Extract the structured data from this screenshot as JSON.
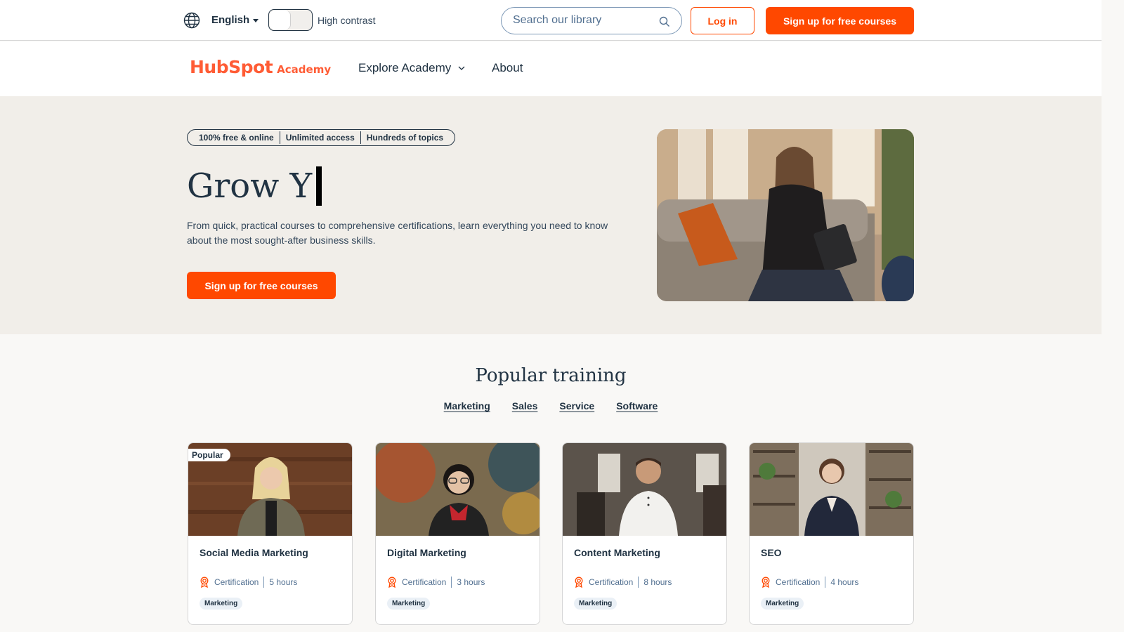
{
  "utility_bar": {
    "language": "English",
    "high_contrast_label": "High contrast",
    "search_placeholder": "Search our library",
    "login_label": "Log in",
    "signup_label": "Sign up for free courses"
  },
  "nav": {
    "logo_primary": "HubSpot",
    "logo_secondary": "Academy",
    "explore_label": "Explore Academy",
    "about_label": "About"
  },
  "hero": {
    "pills": [
      "100% free & online",
      "Unlimited access",
      "Hundreds of topics"
    ],
    "headline": "Grow Y",
    "subtext": "From quick, practical courses to comprehensive certifications, learn everything you need to know about the most sought-after business skills.",
    "cta_label": "Sign up for free courses"
  },
  "popular": {
    "title": "Popular training",
    "tabs": [
      "Marketing",
      "Sales",
      "Service",
      "Software"
    ],
    "cards": [
      {
        "title": "Social Media Marketing",
        "type": "Certification",
        "duration": "5 hours",
        "tag": "Marketing",
        "badge": "Popular"
      },
      {
        "title": "Digital Marketing",
        "type": "Certification",
        "duration": "3 hours",
        "tag": "Marketing"
      },
      {
        "title": "Content Marketing",
        "type": "Certification",
        "duration": "8 hours",
        "tag": "Marketing"
      },
      {
        "title": "SEO",
        "type": "Certification",
        "duration": "4 hours",
        "tag": "Marketing"
      }
    ]
  },
  "colors": {
    "brand_orange": "#ff4800",
    "text_dark": "#213343",
    "hero_bg": "#f1eee9"
  }
}
